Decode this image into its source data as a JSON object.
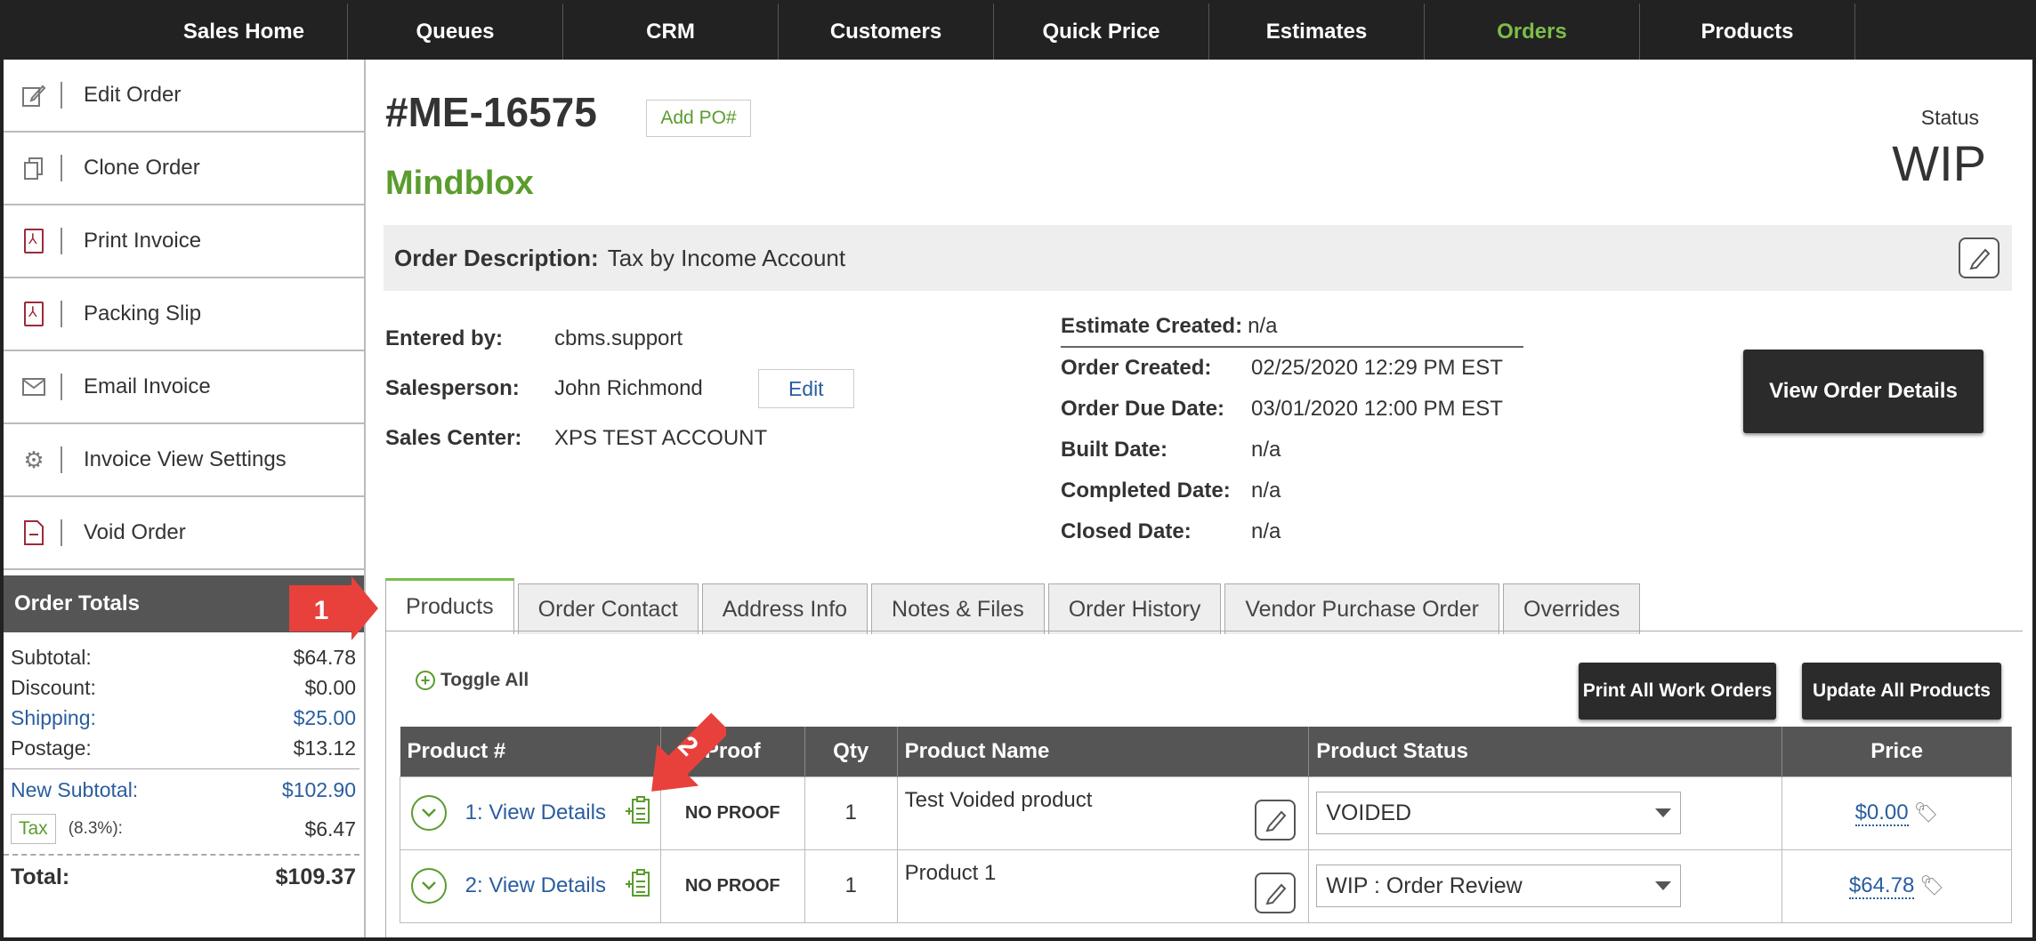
{
  "nav": {
    "items": [
      "Sales Home",
      "Queues",
      "CRM",
      "Customers",
      "Quick Price",
      "Estimates",
      "Orders",
      "Products"
    ],
    "active": "Orders",
    "active_color": "#7dbd4a"
  },
  "sidebar": {
    "actions": [
      {
        "label": "Edit Order",
        "icon": "edit-icon"
      },
      {
        "label": "Clone Order",
        "icon": "copy-icon"
      },
      {
        "label": "Print Invoice",
        "icon": "pdf-icon"
      },
      {
        "label": "Packing Slip",
        "icon": "pdf-icon"
      },
      {
        "label": "Email Invoice",
        "icon": "envelope-icon"
      },
      {
        "label": "Invoice View Settings",
        "icon": "gear-icon"
      },
      {
        "label": "Void Order",
        "icon": "void-document-icon"
      }
    ],
    "totals_title": "Order Totals",
    "totals": {
      "subtotal_label": "Subtotal:",
      "subtotal": "$64.78",
      "discount_label": "Discount:",
      "discount": "$0.00",
      "shipping_label": "Shipping:",
      "shipping": "$25.00",
      "postage_label": "Postage:",
      "postage": "$13.12",
      "new_subtotal_label": "New Subtotal:",
      "new_subtotal": "$102.90",
      "tax_label": "Tax",
      "tax_pct": "(8.3%):",
      "tax": "$6.47",
      "total_label": "Total:",
      "total": "$109.37"
    }
  },
  "callouts": {
    "one": "1",
    "two": "2"
  },
  "order": {
    "number": "#ME-16575",
    "add_po": "Add PO#",
    "status_label": "Status",
    "status": "WIP",
    "company": "Mindblox",
    "description_label": "Order Description:",
    "description": "Tax by Income Account",
    "entered_by_label": "Entered by:",
    "entered_by": "cbms.support",
    "salesperson_label": "Salesperson:",
    "salesperson": "John Richmond",
    "edit_label": "Edit",
    "sales_center_label": "Sales Center:",
    "sales_center": "XPS TEST ACCOUNT",
    "estimate_created_label": "Estimate Created:",
    "estimate_created": "n/a",
    "order_created_label": "Order Created:",
    "order_created": "02/25/2020 12:29 PM EST",
    "order_due_label": "Order Due Date:",
    "order_due": "03/01/2020 12:00 PM EST",
    "built_label": "Built Date:",
    "built": "n/a",
    "completed_label": "Completed Date:",
    "completed": "n/a",
    "closed_label": "Closed Date:",
    "closed": "n/a",
    "view_details_button": "View Order Details"
  },
  "tabs": [
    "Products",
    "Order Contact",
    "Address Info",
    "Notes & Files",
    "Order History",
    "Vendor Purchase Order",
    "Overrides"
  ],
  "products": {
    "toggle_all": "Toggle All",
    "print_all_button": "Print All Work Orders",
    "update_all_button": "Update All Products",
    "columns": [
      "Product #",
      "Proof",
      "Qty",
      "Product Name",
      "Product Status",
      "Price"
    ],
    "rows": [
      {
        "number": "1: View Details",
        "proof": "NO PROOF",
        "qty": "1",
        "name": "Test Voided product",
        "status": "VOIDED",
        "price": "$0.00"
      },
      {
        "number": "2: View Details",
        "proof": "NO PROOF",
        "qty": "1",
        "name": "Product 1",
        "status": "WIP : Order Review",
        "price": "$64.78"
      }
    ]
  }
}
